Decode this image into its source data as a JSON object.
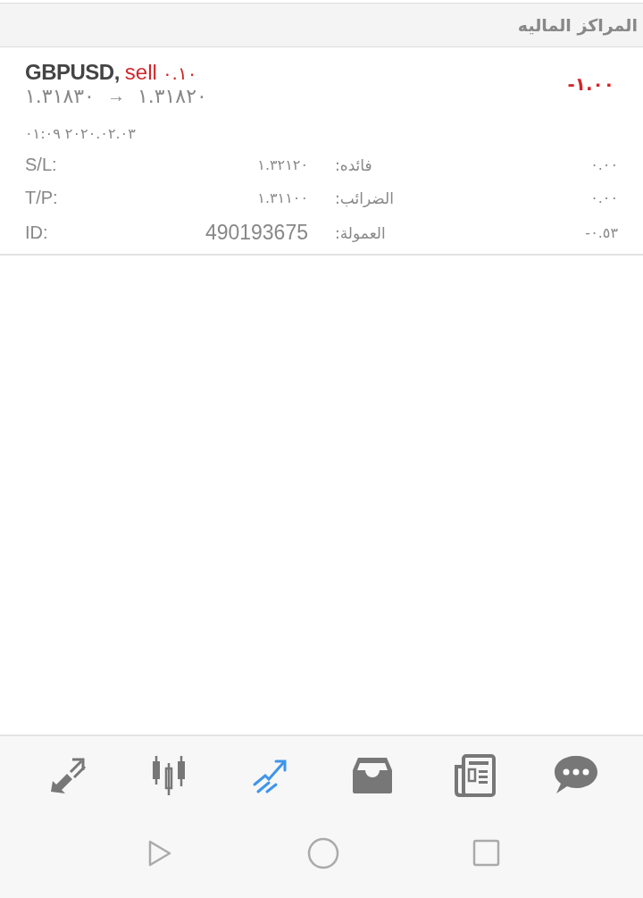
{
  "header": {
    "title": "المراكز الماليه"
  },
  "positions": [
    {
      "symbol": "GBPUSD,",
      "side": "sell",
      "volume": "٠.١٠",
      "open_price": "١.٣١٨٣٠",
      "arrow": "→",
      "current_price": "١.٣١٨٢٠",
      "profit": "-١.٠٠",
      "time": "٠١:٠٩ ٢٠٢٠.٠٢.٠٣",
      "details": [
        {
          "label": "S/L:",
          "value": "١.٣٢١٢٠",
          "label_2": "فائده:",
          "value_2": "٠.٠٠"
        },
        {
          "label": "T/P:",
          "value": "١.٣١١٠٠",
          "label_2": "الضرائب:",
          "value_2": "٠.٠٠"
        },
        {
          "label": "ID:",
          "value": "490193675",
          "label_2": "العمولة:",
          "value_2": "-٠.٥٣"
        }
      ]
    }
  ],
  "tabs": [
    {
      "kind": "trade",
      "selected": false
    },
    {
      "kind": "chart",
      "selected": false
    },
    {
      "kind": "trading",
      "selected": true
    },
    {
      "kind": "inbox",
      "selected": false
    },
    {
      "kind": "news",
      "selected": false
    },
    {
      "kind": "chat",
      "selected": false
    }
  ],
  "nav": [
    {
      "kind": "back"
    },
    {
      "kind": "home"
    },
    {
      "kind": "recents"
    }
  ]
}
